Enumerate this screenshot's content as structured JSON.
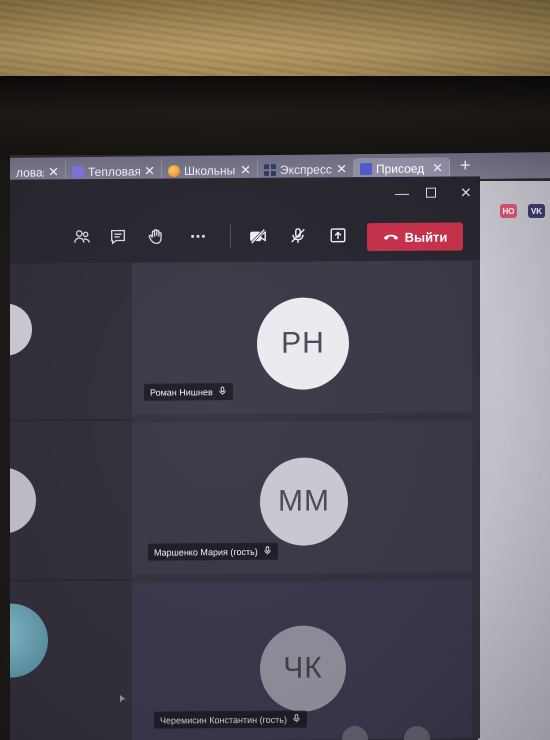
{
  "browser": {
    "tabs": [
      {
        "title": "ловая",
        "favicon": "none",
        "active": false
      },
      {
        "title": "Тепловая",
        "favicon": "purple-cat-icon",
        "active": false
      },
      {
        "title": "Школьны",
        "favicon": "orange-globe-icon",
        "active": false
      },
      {
        "title": "Экспресс",
        "favicon": "grid-icon",
        "active": false
      },
      {
        "title": "Присоед",
        "favicon": "teams-icon",
        "active": true
      }
    ],
    "close_glyph": "✕",
    "new_tab_glyph": "+",
    "extensions": [
      {
        "label": "НО",
        "color": "#d6566f"
      },
      {
        "label": "VK",
        "color": "#3b3c6e"
      }
    ]
  },
  "window": {
    "minimize_glyph": "—",
    "close_glyph": "✕"
  },
  "toolbar": {
    "leave_label": "Выйти",
    "leave_color": "#c4314b",
    "icons": [
      "participants-icon",
      "chat-icon",
      "raise-hand-icon",
      "more-icon",
      "camera-off-icon",
      "mic-off-icon",
      "share-screen-icon"
    ]
  },
  "participants": [
    {
      "initials": "РН",
      "name": "Роман Нишнев"
    },
    {
      "initials": "ММ",
      "name": "Маршенко Мария (гость)"
    },
    {
      "initials": "ЧК",
      "name": "Черемисин Константин (гость)"
    }
  ],
  "colors": {
    "toolbar_bg": "#27252e",
    "stage_bg": "#33303d"
  }
}
